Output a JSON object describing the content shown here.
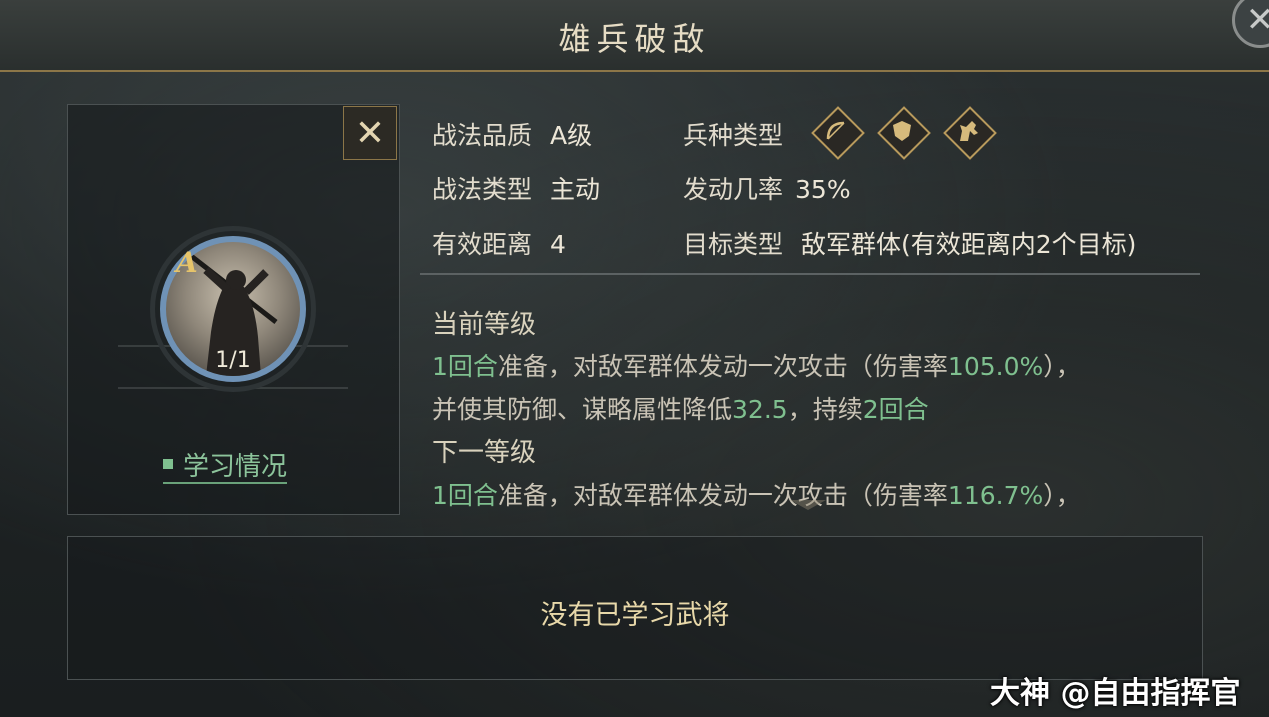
{
  "title": "雄兵破敌",
  "skill": {
    "grade_letter": "A",
    "level_count": "1/1",
    "learn_status_label": "学习情况"
  },
  "info": {
    "quality_label": "战法品质",
    "quality_value": "A级",
    "troop_label": "兵种类型",
    "troop_icons": [
      "bow-icon",
      "shield-icon",
      "horse-icon"
    ],
    "type_label": "战法类型",
    "type_value": "主动",
    "rate_label": "发动几率",
    "rate_value": "35%",
    "range_label": "有效距离",
    "range_value": "4",
    "target_label": "目标类型",
    "target_value": "敌军群体(有效距离内2个目标)"
  },
  "current": {
    "title": "当前等级",
    "line1_a": "1回合",
    "line1_b": "准备，对敌军群体发动一次攻击（伤害率",
    "line1_c": "105.0%",
    "line1_d": "），",
    "line2_a": "并使其防御、谋略属性降低",
    "line2_b": "32.5",
    "line2_c": "，持续",
    "line2_d": "2回合"
  },
  "next": {
    "title": "下一等级",
    "line1_a": "1回合",
    "line1_b": "准备，对敌军群体发动一次攻击（伤害率",
    "line1_c": "116.7%",
    "line1_d": "），"
  },
  "learned": {
    "empty_message": "没有已学习武将"
  },
  "watermark": "大神 @自由指挥官",
  "colors": {
    "accent_gold": "#8c7648",
    "highlight_green": "#7fc08f",
    "portrait_ring": "#6f92b6"
  }
}
